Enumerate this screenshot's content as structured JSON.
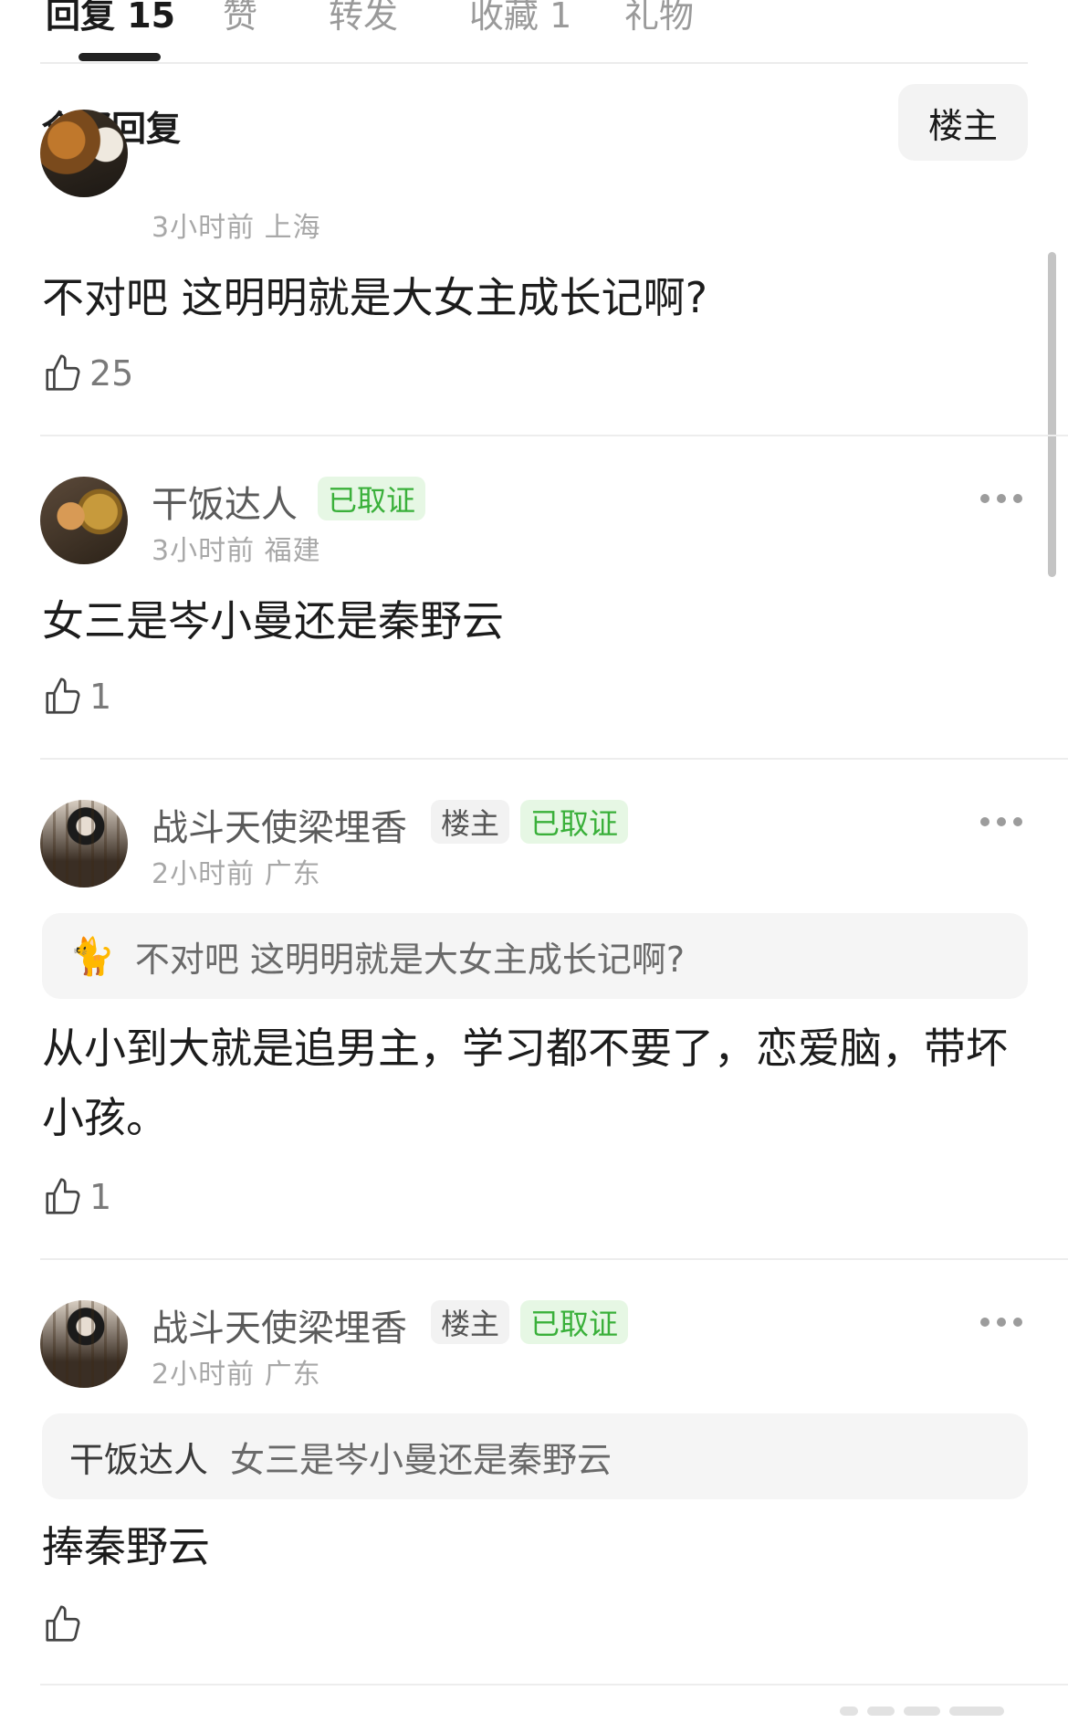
{
  "tabs": [
    {
      "label": "回复 15"
    },
    {
      "label": "赞"
    },
    {
      "label": "转发"
    },
    {
      "label": "收藏 1"
    },
    {
      "label": "礼物"
    }
  ],
  "section": {
    "title": "全部回复",
    "filter_label": "楼主"
  },
  "comments": [
    {
      "meta": "3小时前 上海",
      "text": "不对吧 这明明就是大女主成长记啊?",
      "likes": "25"
    },
    {
      "username": "干饭达人",
      "badge_verified": "已取证",
      "meta": "3小时前 福建",
      "text": "女三是岑小曼还是秦野云",
      "likes": "1"
    },
    {
      "username": "战斗天使梁埋香",
      "badge_op": "楼主",
      "badge_verified": "已取证",
      "meta": "2小时前 广东",
      "quote_emoji": "🐈",
      "quote_text": "不对吧 这明明就是大女主成长记啊?",
      "text": "从小到大就是追男主，学习都不要了，恋爱脑，带坏小孩。",
      "likes": "1"
    },
    {
      "username": "战斗天使梁埋香",
      "badge_op": "楼主",
      "badge_verified": "已取证",
      "meta": "2小时前 广东",
      "quote_author": "干饭达人",
      "quote_text": "女三是岑小曼还是秦野云",
      "text": "捧秦野云",
      "likes": ""
    }
  ],
  "icons": {
    "like": "thumbs-up-icon",
    "more": "more-dots-icon"
  }
}
